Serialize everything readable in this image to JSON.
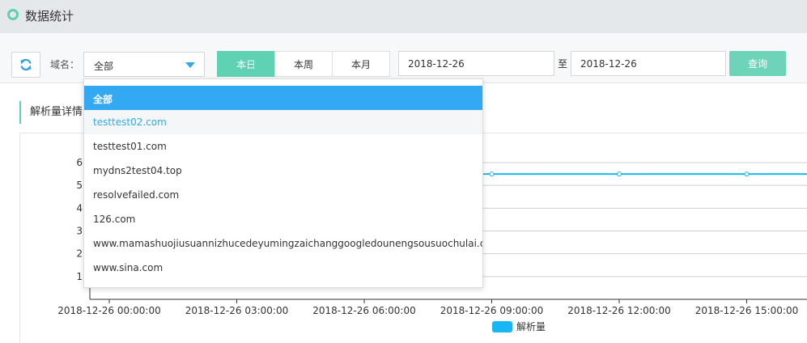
{
  "header": {
    "title": "数据统计"
  },
  "toolbar": {
    "domain_label": "域名：",
    "domain_selected": "全部",
    "range_tabs": [
      "本日",
      "本周",
      "本月"
    ],
    "start_date": "2018-12-26",
    "to_label": "至",
    "end_date": "2018-12-26",
    "query_label": "查询"
  },
  "dropdown": {
    "options": [
      "全部",
      "testtest02.com",
      "testtest01.com",
      "mydns2test04.top",
      "resolvefailed.com",
      "126.com",
      "www.mamashuojiusuannizhucedeyumingzaichanggoogledounengsousuochulai.cn",
      "www.sina.com"
    ],
    "selected_index": 0,
    "hover_index": 1
  },
  "section": {
    "title": "解析量详情"
  },
  "colors": {
    "accent": "#5fd2b4",
    "line": "#19b6f4",
    "selected": "#33a9f3"
  },
  "chart_data": {
    "type": "line",
    "title": "",
    "xlabel": "",
    "ylabel": "",
    "ylim": [
      0,
      6
    ],
    "yticks": [
      "1",
      "2",
      "3",
      "4",
      "5",
      "6"
    ],
    "x": [
      "2018-12-26 00:00:00",
      "2018-12-26 03:00:00",
      "2018-12-26 06:00:00",
      "2018-12-26 09:00:00",
      "2018-12-26 12:00:00",
      "2018-12-26 15:00:00"
    ],
    "series": [
      {
        "name": "解析量",
        "values": [
          5.5,
          5.5,
          5.5,
          5.5,
          5.5,
          5.5
        ]
      }
    ],
    "grid": true,
    "legend": "bottom-center"
  }
}
